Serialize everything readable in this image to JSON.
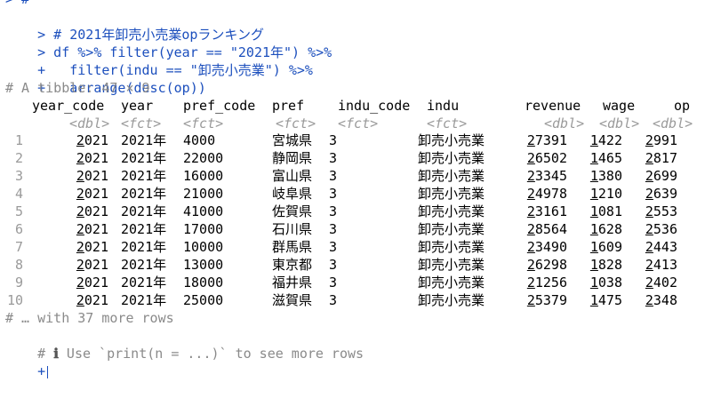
{
  "console": {
    "top_partial": "> #",
    "cmd1_prompt": ">",
    "cmd1_text": " # 2021年卸売小売業opランキング",
    "cmd2_prompt": ">",
    "cmd2_text": " df %>% filter(year == \"2021年\") %>%",
    "cmd3_prompt": "+",
    "cmd3_text": "   filter(indu == \"卸売小売業\") %>%",
    "cmd4_prompt": "+",
    "cmd4_text": "   arrange(desc(op))",
    "tibble_header": "# A tibble: 47 × 9",
    "footer1": "# … with 37 more rows",
    "footer2_hash": "#",
    "footer2_icon": "ℹ",
    "footer2_text": " Use `print(n = ...)` to see more rows",
    "final_prompt": "+"
  },
  "table": {
    "columns": [
      {
        "name": "year_code",
        "type": "<dbl>"
      },
      {
        "name": "year",
        "type": "<fct>"
      },
      {
        "name": "pref_code",
        "type": "<fct>"
      },
      {
        "name": "pref",
        "type": "<fct>"
      },
      {
        "name": "indu_code",
        "type": "<fct>"
      },
      {
        "name": "indu",
        "type": "<fct>"
      },
      {
        "name": "revenue",
        "type": "<dbl>"
      },
      {
        "name": "wage",
        "type": "<dbl>"
      },
      {
        "name": "op",
        "type": "<dbl>"
      }
    ],
    "rows": [
      {
        "n": "1",
        "year_code": "2021",
        "year": "2021年",
        "pref_code": "4000",
        "pref": "宮城県",
        "indu_code": "3",
        "indu": "卸売小売業",
        "revenue": "27391",
        "wage": "1422",
        "op": "2991"
      },
      {
        "n": "2",
        "year_code": "2021",
        "year": "2021年",
        "pref_code": "22000",
        "pref": "静岡県",
        "indu_code": "3",
        "indu": "卸売小売業",
        "revenue": "26502",
        "wage": "1465",
        "op": "2817"
      },
      {
        "n": "3",
        "year_code": "2021",
        "year": "2021年",
        "pref_code": "16000",
        "pref": "富山県",
        "indu_code": "3",
        "indu": "卸売小売業",
        "revenue": "23345",
        "wage": "1380",
        "op": "2699"
      },
      {
        "n": "4",
        "year_code": "2021",
        "year": "2021年",
        "pref_code": "21000",
        "pref": "岐阜県",
        "indu_code": "3",
        "indu": "卸売小売業",
        "revenue": "24978",
        "wage": "1210",
        "op": "2639"
      },
      {
        "n": "5",
        "year_code": "2021",
        "year": "2021年",
        "pref_code": "41000",
        "pref": "佐賀県",
        "indu_code": "3",
        "indu": "卸売小売業",
        "revenue": "23161",
        "wage": "1081",
        "op": "2553"
      },
      {
        "n": "6",
        "year_code": "2021",
        "year": "2021年",
        "pref_code": "17000",
        "pref": "石川県",
        "indu_code": "3",
        "indu": "卸売小売業",
        "revenue": "28564",
        "wage": "1628",
        "op": "2536"
      },
      {
        "n": "7",
        "year_code": "2021",
        "year": "2021年",
        "pref_code": "10000",
        "pref": "群馬県",
        "indu_code": "3",
        "indu": "卸売小売業",
        "revenue": "23490",
        "wage": "1609",
        "op": "2443"
      },
      {
        "n": "8",
        "year_code": "2021",
        "year": "2021年",
        "pref_code": "13000",
        "pref": "東京都",
        "indu_code": "3",
        "indu": "卸売小売業",
        "revenue": "26298",
        "wage": "1828",
        "op": "2413"
      },
      {
        "n": "9",
        "year_code": "2021",
        "year": "2021年",
        "pref_code": "18000",
        "pref": "福井県",
        "indu_code": "3",
        "indu": "卸売小売業",
        "revenue": "21256",
        "wage": "1038",
        "op": "2402"
      },
      {
        "n": "10",
        "year_code": "2021",
        "year": "2021年",
        "pref_code": "25000",
        "pref": "滋賀県",
        "indu_code": "3",
        "indu": "卸売小売業",
        "revenue": "25379",
        "wage": "1475",
        "op": "2348"
      }
    ]
  }
}
